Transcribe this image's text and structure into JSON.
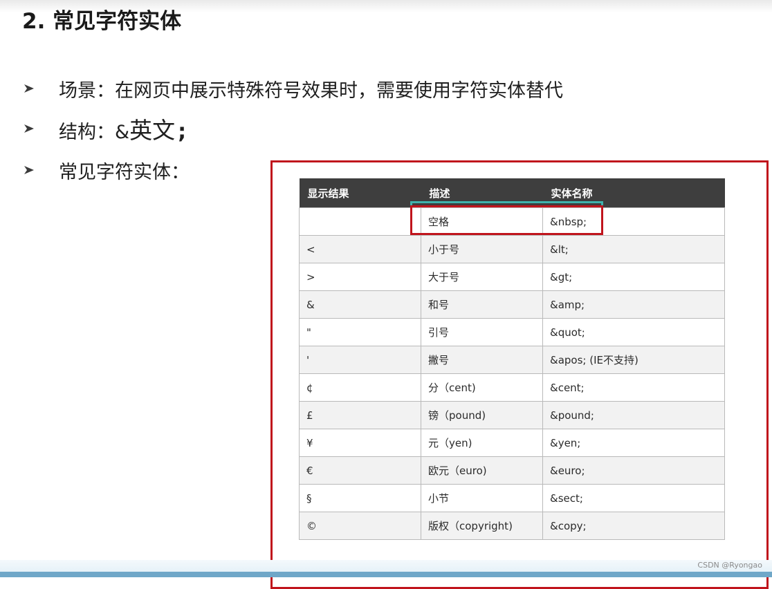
{
  "slide": {
    "title": "2. 常见字符实体",
    "bullets": [
      {
        "label": "场景：",
        "text": "在网页中展示特殊符号效果时，需要使用字符实体替代"
      },
      {
        "label": "结构：",
        "amp": "&",
        "serif_text": "英文",
        "semicolon": ";"
      },
      {
        "label": "常见字符实体："
      }
    ]
  },
  "table": {
    "headers": [
      "显示结果",
      "描述",
      "实体名称"
    ],
    "rows": [
      {
        "result": "",
        "desc": "空格",
        "entity": "&nbsp;"
      },
      {
        "result": "<",
        "desc": "小于号",
        "entity": "&lt;"
      },
      {
        "result": ">",
        "desc": "大于号",
        "entity": "&gt;"
      },
      {
        "result": "&",
        "desc": "和号",
        "entity": "&amp;"
      },
      {
        "result": "\"",
        "desc": "引号",
        "entity": "&quot;"
      },
      {
        "result": "'",
        "desc": "撇号",
        "entity": "&apos; (IE不支持)"
      },
      {
        "result": "¢",
        "desc": "分（cent)",
        "entity": "&cent;"
      },
      {
        "result": "£",
        "desc": "镑（pound)",
        "entity": "&pound;"
      },
      {
        "result": "¥",
        "desc": "元（yen)",
        "entity": "&yen;"
      },
      {
        "result": "€",
        "desc": "欧元（euro)",
        "entity": "&euro;"
      },
      {
        "result": "§",
        "desc": "小节",
        "entity": "&sect;"
      },
      {
        "result": "©",
        "desc": "版权（copyright)",
        "entity": "&copy;"
      }
    ]
  },
  "watermark": "CSDN @Ryongao",
  "icons": {
    "bullet": "triangle-bullet-icon"
  },
  "colors": {
    "highlight_red": "#c0141c",
    "highlight_teal": "#3fb3ad",
    "header_bg": "#3e3e3e",
    "row_alt_bg": "#f2f2f2"
  }
}
